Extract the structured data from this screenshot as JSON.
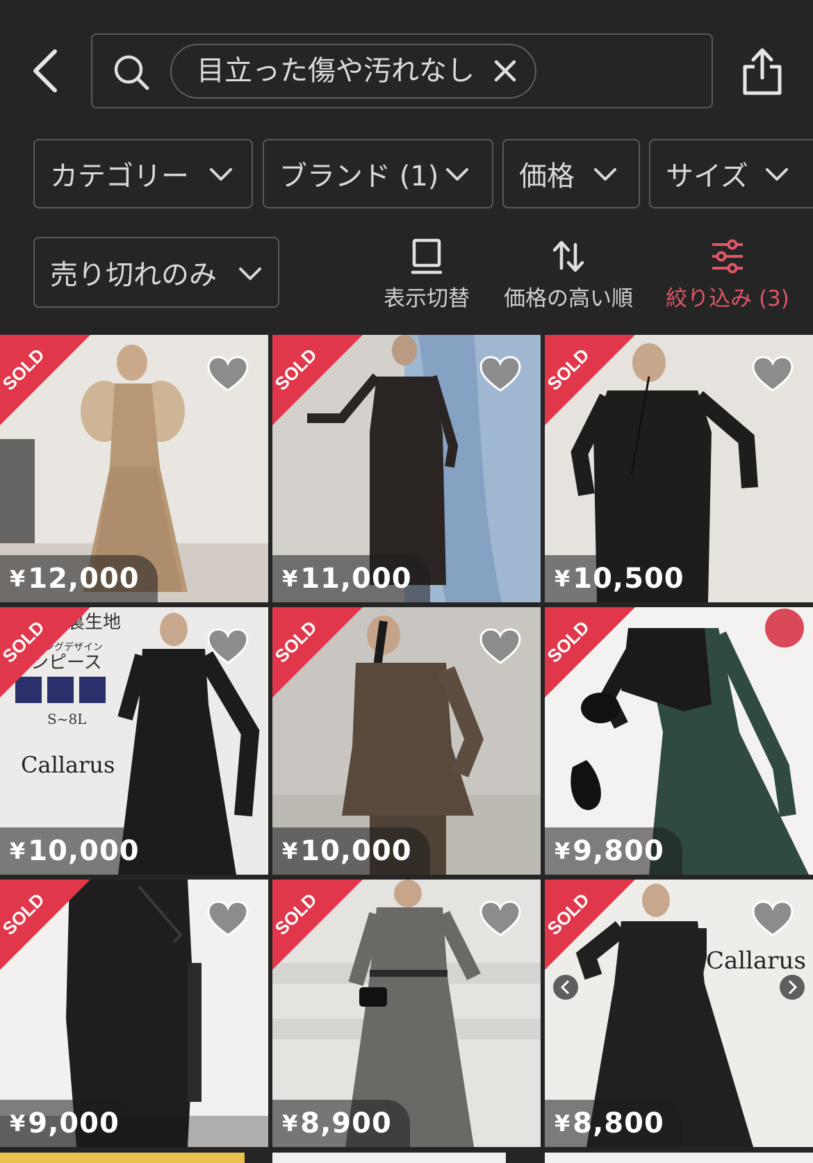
{
  "search": {
    "query": "目立った傷や汚れなし"
  },
  "filters": [
    {
      "label": "カテゴリー"
    },
    {
      "label": "ブランド (1)"
    },
    {
      "label": "価格"
    },
    {
      "label": "サイズ"
    }
  ],
  "status_filter": {
    "label": "売り切れのみ"
  },
  "toolbar": {
    "display_toggle": "表示切替",
    "sort": "価格の高い順",
    "refine": "絞り込み (3)"
  },
  "colors": {
    "background": "#252526",
    "accent": "#e25666",
    "sold_ribbon": "#e0374b"
  },
  "items": [
    {
      "sold_label": "SOLD",
      "currency": "¥",
      "price": "12,000"
    },
    {
      "sold_label": "SOLD",
      "currency": "¥",
      "price": "11,000"
    },
    {
      "sold_label": "SOLD",
      "currency": "¥",
      "price": "10,500"
    },
    {
      "sold_label": "SOLD",
      "currency": "¥",
      "price": "10,000",
      "photo_text": [
        "裏生地",
        "イピングデザイン",
        "ンピース",
        "S~8L",
        "Callarus"
      ]
    },
    {
      "sold_label": "SOLD",
      "currency": "¥",
      "price": "10,000"
    },
    {
      "sold_label": "SOLD",
      "currency": "¥",
      "price": "9,800"
    },
    {
      "sold_label": "SOLD",
      "currency": "¥",
      "price": "9,000"
    },
    {
      "sold_label": "SOLD",
      "currency": "¥",
      "price": "8,900"
    },
    {
      "sold_label": "SOLD",
      "currency": "¥",
      "price": "8,800",
      "photo_text": [
        "Callarus"
      ]
    }
  ]
}
